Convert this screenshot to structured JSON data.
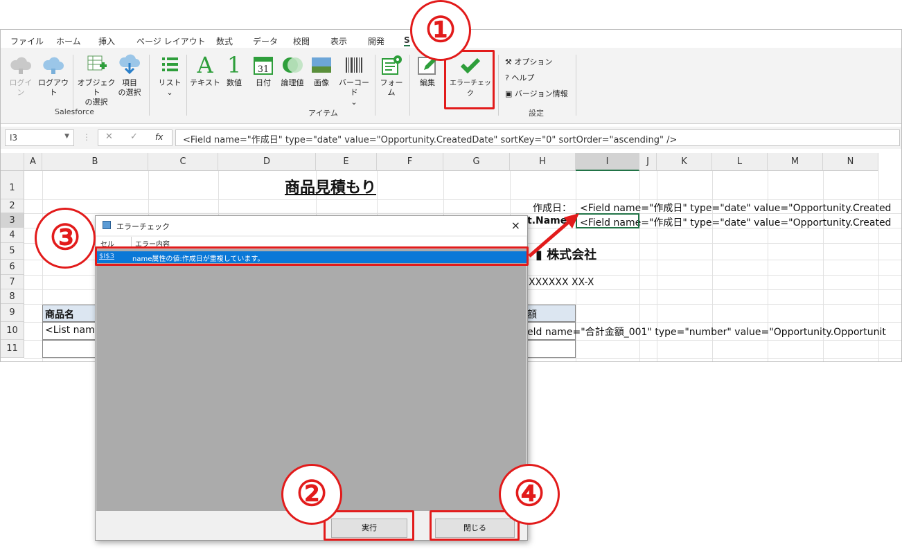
{
  "ribbon_tabs": [
    "ファイル",
    "ホーム",
    "挿入",
    "ページ レイアウト",
    "数式",
    "データ",
    "校閲",
    "表示",
    "開発",
    "S"
  ],
  "ribbon": {
    "login": "ログイン",
    "logout": "ログアウト",
    "select_object_1": "オブジェクト",
    "select_object_2": "の選択",
    "select_item_1": "項目",
    "select_item_2": "の選択",
    "group_salesforce": "Salesforce",
    "list": "リスト",
    "text": "テキスト",
    "number": "数値",
    "date": "日付",
    "boolean": "論理値",
    "image": "画像",
    "barcode": "バーコード",
    "form": "フォーム",
    "edit": "編集",
    "error_check": "エラーチェック",
    "group_items": "アイテム",
    "options": "オプション",
    "help": "ヘルプ",
    "version": "バージョン情報",
    "group_settings": "設定",
    "calendar_num": "31",
    "number_glyph": "1",
    "text_glyph": "A"
  },
  "formula_bar": {
    "name_box": "I3",
    "fx": "fx",
    "formula": "<Field name=\"作成日\" type=\"date\" value=\"Opportunity.CreatedDate\" sortKey=\"0\" sortOrder=\"ascending\" />"
  },
  "columns": [
    "A",
    "B",
    "C",
    "D",
    "E",
    "F",
    "G",
    "H",
    "I",
    "J",
    "K",
    "L",
    "M",
    "N"
  ],
  "rows": [
    "1",
    "2",
    "3",
    "4",
    "5",
    "6",
    "7",
    "8",
    "9",
    "10",
    "11"
  ],
  "cells": {
    "title": "商品見積もり",
    "h2": "作成日：",
    "i2": "<Field name=\"作成日\" type=\"date\" value=\"Opportunity.Created",
    "h3": "t.Name\"",
    "i3": "<Field name=\"作成日\" type=\"date\" value=\"Opportunity.Created",
    "h5": "株式会社",
    "h7": "XXXXXX XX-X",
    "b9": "商品名",
    "h9": "額",
    "b10": "<List nam",
    "h10": "eld name=\"合計金額_001\" type=\"number\" value=\"Opportunity.Opportunit"
  },
  "dialog": {
    "title": "エラーチェック",
    "col_cell": "セル",
    "col_content": "エラー内容",
    "row_cell": "$I$3",
    "row_message": "name属性の値:作成日が重複しています。",
    "run_label": "実行",
    "close_label": "閉じる",
    "close_x": "×"
  },
  "callouts": [
    "①",
    "②",
    "③",
    "④"
  ],
  "colors": {
    "annotation_red": "#e21b1b",
    "selection_blue": "#0a78d7",
    "check_green": "#2e9e3b"
  }
}
